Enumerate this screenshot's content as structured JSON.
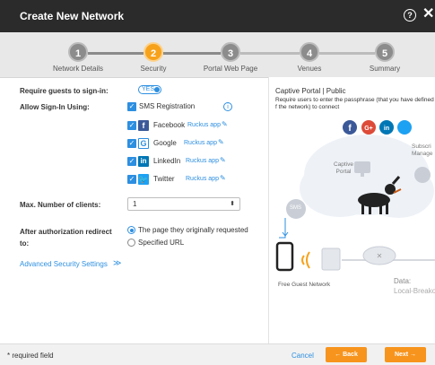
{
  "header": {
    "title": "Create New Network",
    "help": "?",
    "close": "✕"
  },
  "wizard": {
    "steps": [
      {
        "num": "1",
        "label": "Network Details"
      },
      {
        "num": "2",
        "label": "Security"
      },
      {
        "num": "3",
        "label": "Portal Web Page"
      },
      {
        "num": "4",
        "label": "Venues"
      },
      {
        "num": "5",
        "label": "Summary"
      }
    ],
    "active_step": 2
  },
  "form": {
    "require_label": "Require guests to sign-in:",
    "require_toggle": "YES",
    "allow_label": "Allow Sign-In Using:",
    "sms_label": "SMS Registration",
    "facebook_label": "Facebook",
    "google_label": "Google",
    "linkedin_label": "LinkedIn",
    "twitter_label": "Twitter",
    "ruckus_app": "Ruckus app",
    "max_clients_label": "Max. Number of clients:",
    "max_clients_value": "1",
    "redirect_label": "After authorization redirect to:",
    "redirect_opt1": "The page they originally requested",
    "redirect_opt2": "Specified URL",
    "advanced_link": "Advanced Security Settings"
  },
  "preview": {
    "title": "Captive Portal | Public",
    "description": "Require users to enter the passphrase (that you have defined f the network) to connect",
    "captive_portal": "Captive Portal",
    "subscriber": "Subscri Manage",
    "sms": "SMS",
    "free_guest": "Free Guest Network",
    "data_label": "Data:",
    "data_value": "Local-Breako"
  },
  "footer": {
    "required_note": "* required field",
    "cancel": "Cancel",
    "back": "← Back",
    "next": "Next →"
  },
  "colors": {
    "accent": "#f7a21b",
    "link": "#2d8fe0",
    "titlebar": "#2b2b2b"
  }
}
